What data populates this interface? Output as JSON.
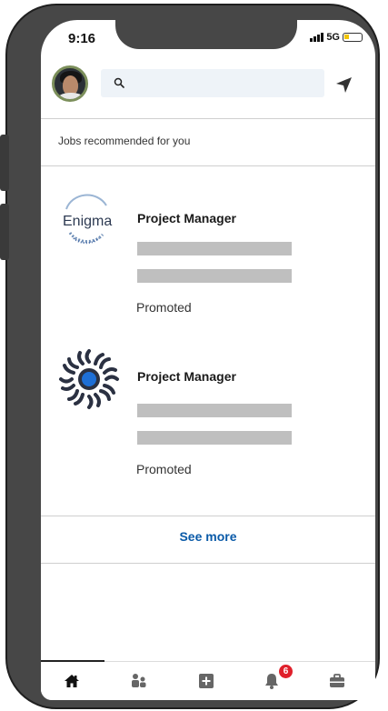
{
  "status_bar": {
    "time": "9:16",
    "network": "5G"
  },
  "header": {
    "search_placeholder": ""
  },
  "section": {
    "title": "Jobs recommended for you"
  },
  "jobs": [
    {
      "company_logo_text": "Enigma",
      "title": "Project Manager",
      "label": "Promoted"
    },
    {
      "company_logo_text": "",
      "title": "Project Manager",
      "label": "Promoted"
    }
  ],
  "see_more_label": "See more",
  "bottom_nav": {
    "items": [
      "home-icon",
      "my-network-icon",
      "post-icon",
      "notifications-icon",
      "jobs-icon"
    ],
    "notification_count": "6",
    "active": "home"
  },
  "colors": {
    "link": "#0a5aa8",
    "badge": "#e0202b",
    "placeholder_bar": "#bfbfbf",
    "search_bg": "#eef3f8"
  }
}
